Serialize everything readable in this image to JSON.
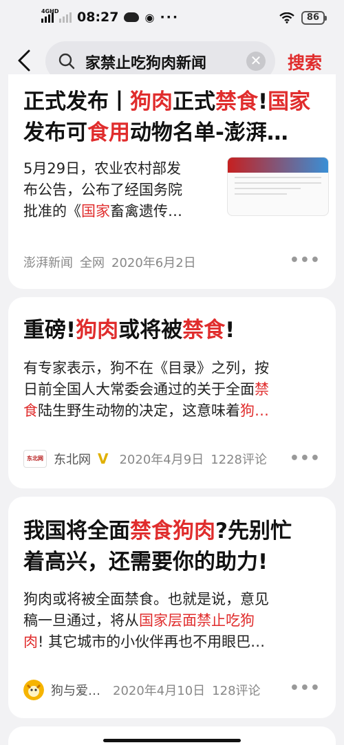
{
  "status_bar": {
    "network": "4GHD",
    "time": "08:27",
    "extra": "···",
    "battery": "86"
  },
  "search": {
    "query": "家禁止吃狗肉新闻",
    "button_label": "搜索"
  },
  "results": [
    {
      "title_parts": [
        "正式发布丨",
        "狗肉",
        "正式",
        "禁食",
        "!",
        "国家",
        "发布可",
        "食用",
        "动物名单-澎湃…"
      ],
      "body_lines": [
        "5月29日，农业农村部发",
        "布公告，公布了经国务院",
        "批准的《",
        "国家",
        "畜禽遗传…"
      ],
      "source": "澎湃新闻",
      "scope": "全网",
      "date": "2020年6月2日"
    },
    {
      "title_parts": [
        "重磅!",
        "狗肉",
        "或将被",
        "禁食",
        "!"
      ],
      "body_lines": [
        "有专家表示，狗不在《目录》之列，按",
        "日前全国人大常委会通过的关于全面",
        "禁",
        "食",
        "陆生野生动物的决定，这意味着",
        "狗…"
      ],
      "source": "东北网",
      "verified": "V",
      "logo_text": "东北网",
      "date": "2020年4月9日",
      "comments": "1228评论"
    },
    {
      "title_parts": [
        "我国将全面",
        "禁食狗肉",
        "?先别忙",
        "着高兴，还需要你的助力!"
      ],
      "body_lines": [
        "狗肉或将被全面禁食。也就是说，意见",
        "稿一旦通过，将从",
        "国家层面禁止吃狗",
        "肉",
        "! 其它城市的小伙伴再也不用眼巴…"
      ],
      "source": "狗与爱…",
      "date": "2020年4月10日",
      "comments": "128评论"
    }
  ],
  "more_label": "•••",
  "colors": {
    "highlight": "#e02d2d",
    "background": "#f2f2f4",
    "card": "#ffffff"
  }
}
